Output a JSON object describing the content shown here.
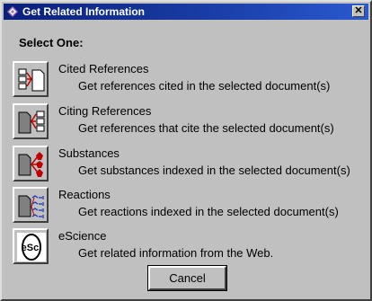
{
  "window": {
    "title": "Get Related Information",
    "close_label": "✕"
  },
  "heading": "Select One:",
  "options": [
    {
      "title": "Cited References",
      "description": "Get references cited in the selected document(s)",
      "icon": "cited-references-icon"
    },
    {
      "title": "Citing References",
      "description": "Get references that cite the selected document(s)",
      "icon": "citing-references-icon"
    },
    {
      "title": "Substances",
      "description": "Get substances indexed in the selected document(s)",
      "icon": "substances-icon"
    },
    {
      "title": "Reactions",
      "description": "Get reactions indexed in the selected document(s)",
      "icon": "reactions-icon"
    },
    {
      "title": "eScience",
      "description": "Get related information from the Web.",
      "icon": "escience-icon",
      "icon_text": "eSci"
    }
  ],
  "cancel_label": "Cancel",
  "colors": {
    "titlebar": "#0a1f7a",
    "face": "#c0c0c0",
    "arrow_red": "#c00000"
  }
}
